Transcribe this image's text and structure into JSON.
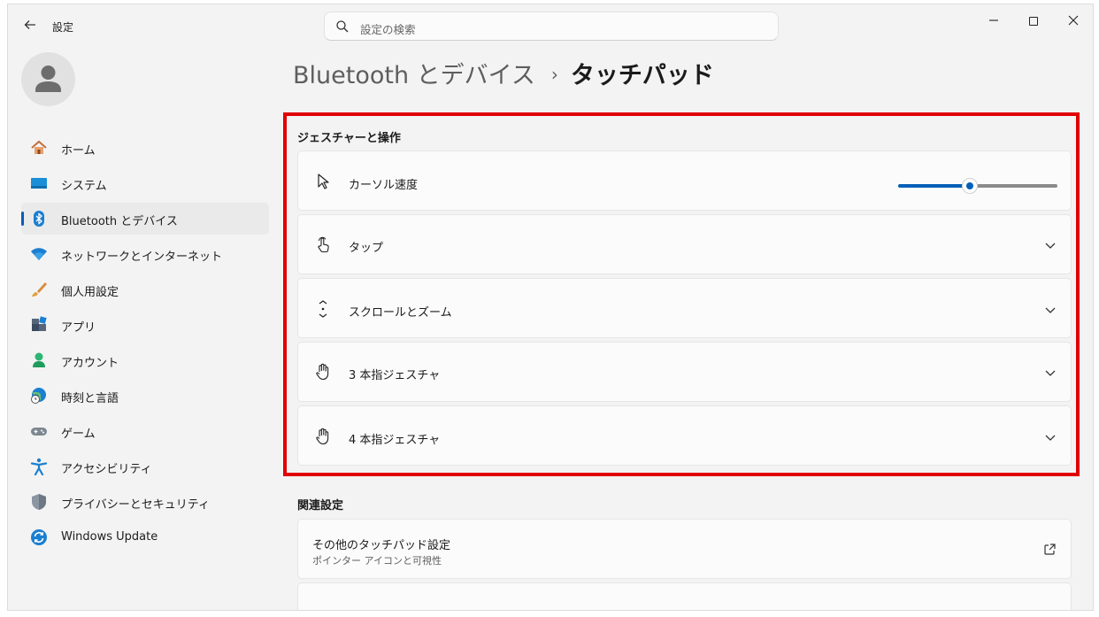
{
  "window": {
    "app_title": "設定"
  },
  "search": {
    "placeholder": "設定の検索"
  },
  "sidebar": {
    "items": [
      {
        "label": "ホーム",
        "icon": "home-icon"
      },
      {
        "label": "システム",
        "icon": "system-icon"
      },
      {
        "label": "Bluetooth とデバイス",
        "icon": "bluetooth-icon",
        "active": true
      },
      {
        "label": "ネットワークとインターネット",
        "icon": "wifi-icon"
      },
      {
        "label": "個人用設定",
        "icon": "brush-icon"
      },
      {
        "label": "アプリ",
        "icon": "apps-icon"
      },
      {
        "label": "アカウント",
        "icon": "account-icon"
      },
      {
        "label": "時刻と言語",
        "icon": "globe-clock-icon"
      },
      {
        "label": "ゲーム",
        "icon": "gamepad-icon"
      },
      {
        "label": "アクセシビリティ",
        "icon": "accessibility-icon"
      },
      {
        "label": "プライバシーとセキュリティ",
        "icon": "shield-icon"
      },
      {
        "label": "Windows Update",
        "icon": "windows-update-icon"
      }
    ]
  },
  "breadcrumb": {
    "parent": "Bluetooth とデバイス",
    "separator": "›",
    "current": "タッチパッド"
  },
  "gestures": {
    "title": "ジェスチャーと操作",
    "cursor_speed": {
      "label": "カーソル速度",
      "value_fraction": 0.45
    },
    "items": [
      {
        "label": "タップ",
        "icon": "tap-icon"
      },
      {
        "label": "スクロールとズーム",
        "icon": "scroll-icon"
      },
      {
        "label": "3 本指ジェスチャ",
        "icon": "hand-icon"
      },
      {
        "label": "4 本指ジェスチャ",
        "icon": "hand-icon"
      }
    ]
  },
  "related": {
    "title": "関連設定",
    "more_touchpad": {
      "label": "その他のタッチパッド設定",
      "sublabel": "ポインター アイコンと可視性"
    }
  },
  "colors": {
    "accent": "#005fb8",
    "highlight_border": "#e00000",
    "background": "#f3f3f3",
    "card": "#fbfbfb"
  }
}
